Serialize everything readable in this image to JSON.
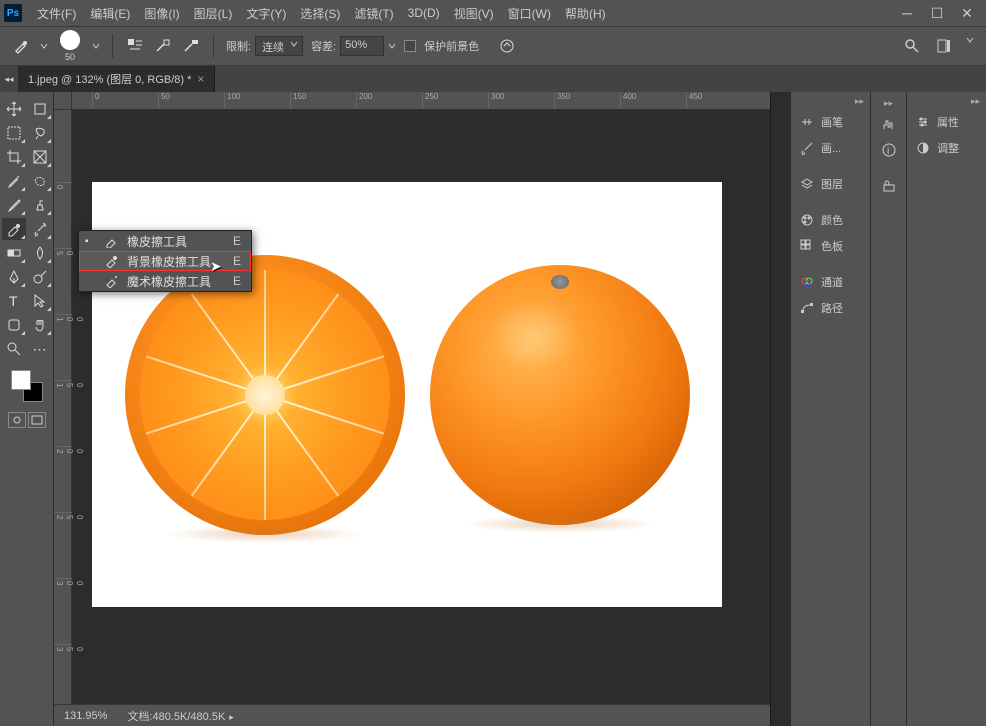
{
  "app": {
    "logo": "Ps"
  },
  "menu": [
    "文件(F)",
    "编辑(E)",
    "图像(I)",
    "图层(L)",
    "文字(Y)",
    "选择(S)",
    "滤镜(T)",
    "3D(D)",
    "视图(V)",
    "窗口(W)",
    "帮助(H)"
  ],
  "options": {
    "brush_size": "50",
    "limit_label": "限制:",
    "limit_value": "连续",
    "tolerance_label": "容差:",
    "tolerance_value": "50%",
    "protect_fg": "保护前景色"
  },
  "document": {
    "tab": "1.jpeg @ 132% (图层 0, RGB/8) *"
  },
  "ruler_h": [
    "0",
    "50",
    "100",
    "150",
    "200",
    "250",
    "300",
    "350",
    "400",
    "450"
  ],
  "ruler_v": [
    "0",
    "5",
    "0",
    "1",
    "0",
    "0",
    "1",
    "5",
    "0",
    "2",
    "0",
    "0",
    "2",
    "5",
    "0",
    "3",
    "0",
    "0",
    "3",
    "5",
    "0"
  ],
  "flyout": [
    {
      "label": "橡皮擦工具",
      "key": "E",
      "checked": true
    },
    {
      "label": "背景橡皮擦工具",
      "key": "E",
      "checked": false,
      "highlighted": true
    },
    {
      "label": "魔术橡皮擦工具",
      "key": "E",
      "checked": false
    }
  ],
  "panels_a": [
    "画笔",
    "画..."
  ],
  "panels_b": [
    "图层",
    "颜色",
    "色板"
  ],
  "panels_c": [
    "通道",
    "路径"
  ],
  "panels_right": [
    "属性",
    "调整"
  ],
  "status": {
    "zoom": "131.95%",
    "doc": "文档:480.5K/480.5K"
  }
}
